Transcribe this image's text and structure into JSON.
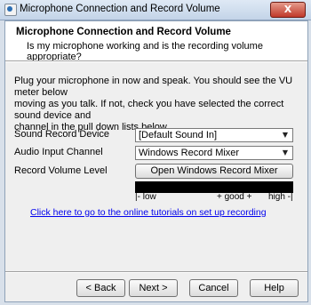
{
  "window": {
    "title": "Microphone Connection and Record Volume",
    "close_label": "X"
  },
  "header": {
    "title": "Microphone Connection and Record Volume",
    "subtitle": "Is my microphone working and is the recording volume appropriate?"
  },
  "intro": {
    "line1": "Plug your microphone in now and speak. You should see the VU meter below",
    "line2": "moving as you talk. If not, check you have selected the correct sound device and",
    "line3": "channel in the pull down lists below."
  },
  "fields": {
    "sound_record_device": {
      "label": "Sound Record Device",
      "value": "[Default Sound In]"
    },
    "audio_input_channel": {
      "label": "Audio Input Channel",
      "value": "Windows Record Mixer"
    },
    "record_volume_level": {
      "label": "Record Volume Level",
      "button": "Open Windows Record Mixer"
    }
  },
  "vu_meter": {
    "low": "low",
    "good": "good",
    "high": "high"
  },
  "tutorial_link": "Click here to go to the online tutorials on set up recording",
  "buttons": {
    "back": "< Back",
    "next": "Next >",
    "cancel": "Cancel",
    "help": "Help"
  }
}
